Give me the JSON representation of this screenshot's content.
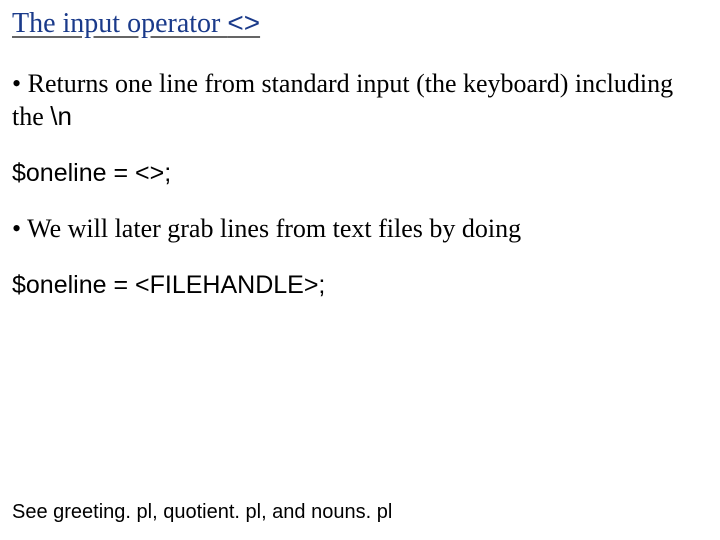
{
  "title": {
    "text": "The input operator ",
    "operator": "<>"
  },
  "body": {
    "bullet1_prefix": "• ",
    "bullet1_main": "Returns one line from standard input (the keyboard) including the ",
    "bullet1_code": "\\n",
    "code1": "$oneline = <>;",
    "bullet2_prefix": "• ",
    "bullet2_main": "We will later grab lines from text files by doing",
    "code2": "$oneline = <FILEHANDLE>;"
  },
  "footer": "See greeting. pl, quotient. pl, and nouns. pl"
}
